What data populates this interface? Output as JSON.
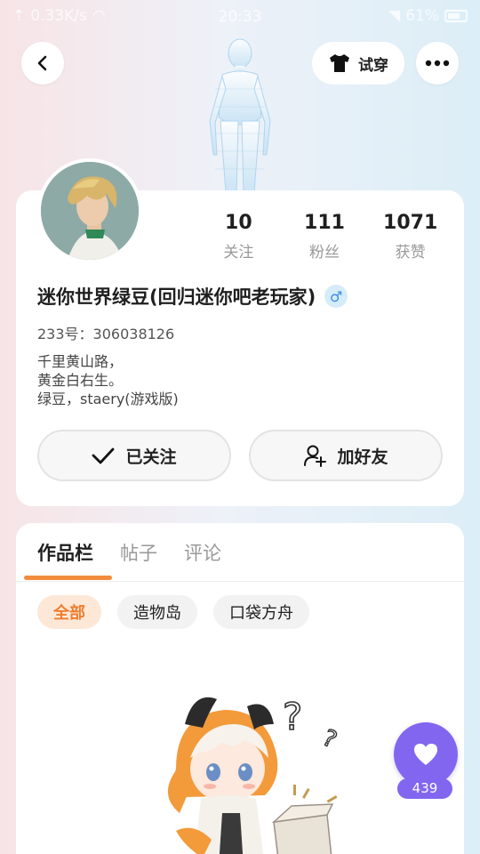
{
  "status_bar": {
    "network_speed": "0.33K/s",
    "time": "20:33",
    "battery": "61%"
  },
  "header": {
    "try_on_label": "试穿"
  },
  "profile": {
    "stats": [
      {
        "value": "10",
        "label": "关注"
      },
      {
        "value": "111",
        "label": "粉丝"
      },
      {
        "value": "1071",
        "label": "获赞"
      }
    ],
    "username": "迷你世界绿豆(回归迷你吧老玩家)",
    "gender_symbol": "♂",
    "uid": "233号：306038126",
    "bio_lines": [
      "千里黄山路，",
      "黄金白右生。",
      "绿豆，staery(游戏版)"
    ],
    "follow_button": "已关注",
    "add_friend_button": "加好友"
  },
  "works": {
    "tabs": [
      "作品栏",
      "帖子",
      "评论"
    ],
    "active_tab": 0,
    "chips": [
      "全部",
      "造物岛",
      "口袋方舟"
    ],
    "active_chip": 0
  },
  "like": {
    "count": "439"
  },
  "colors": {
    "accent_orange": "#f28c3c",
    "like_purple": "#8266f0",
    "gender_blue": "#3a8ee0"
  }
}
